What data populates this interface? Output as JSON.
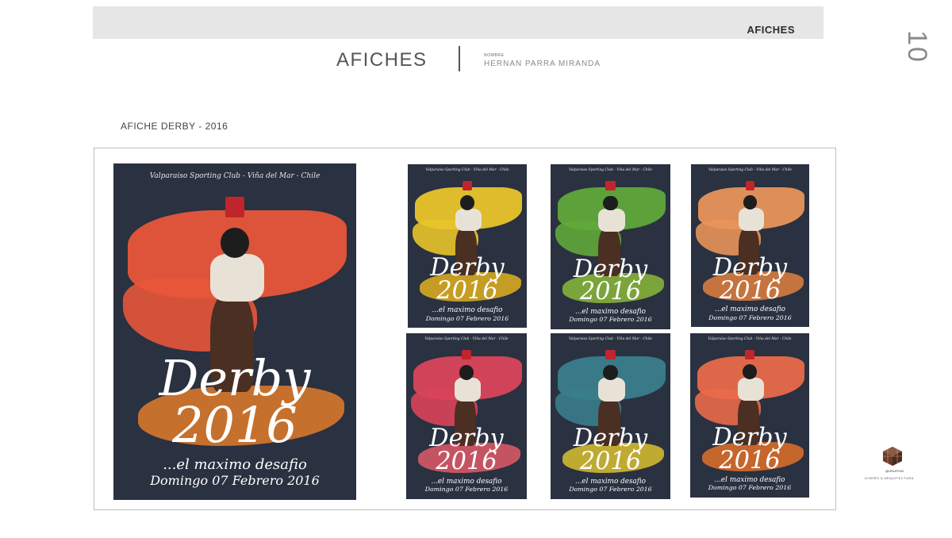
{
  "header": {
    "bar_label": "AFICHES",
    "page_number": "10",
    "title": "AFICHES",
    "meta_label": "NOMBRE",
    "meta_value": "HERNAN PARRA MIRANDA"
  },
  "subsection": "AFICHE DERBY - 2016",
  "posters": [
    {
      "variant": "main",
      "accent": "#e8563a",
      "accent2": "#f2a23a",
      "accent3": "#e07b2a"
    },
    {
      "variant": "yellow",
      "accent": "#e8c42a",
      "accent2": "#d9a820",
      "accent3": "#e0b020"
    },
    {
      "variant": "green",
      "accent": "#5fa83a",
      "accent2": "#d9c030",
      "accent3": "#8ab83a"
    },
    {
      "variant": "peach",
      "accent": "#e8935a",
      "accent2": "#f0a860",
      "accent3": "#e08040"
    },
    {
      "variant": "pink",
      "accent": "#d9445a",
      "accent2": "#e8a030",
      "accent3": "#e05a6a"
    },
    {
      "variant": "teal",
      "accent": "#3a7d8c",
      "accent2": "#e8a030",
      "accent3": "#d9c030"
    },
    {
      "variant": "salmon",
      "accent": "#e86a4a",
      "accent2": "#e8a030",
      "accent3": "#e0702a"
    }
  ],
  "poster_text": {
    "top": "Valparaiso Sporting Club - Viña del Mar - Chile",
    "derby": "Derby",
    "year": "2016",
    "tagline": "...el maximo desafio",
    "date": "Domingo 07 Febrero 2016"
  },
  "logo": {
    "brand": "@GRUPO42",
    "caption": "DISEÑO & ARQUITECTURA",
    "color": "#6b3a2a"
  }
}
